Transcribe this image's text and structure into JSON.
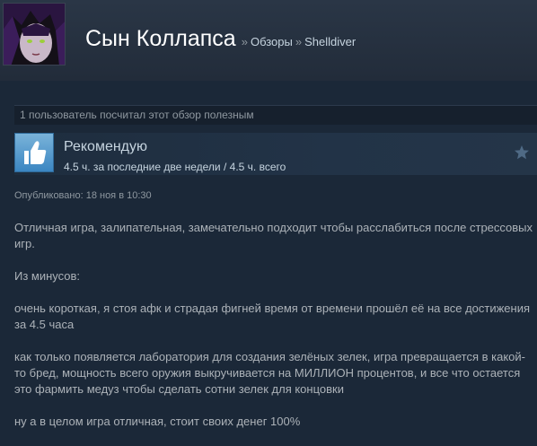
{
  "header": {
    "persona_name": "Сын Коллапса",
    "breadcrumb_sep": "»",
    "breadcrumb_reviews": "Обзоры",
    "breadcrumb_game": "Shelldiver"
  },
  "helpful": {
    "text": "1 пользователь посчитал этот обзор полезным"
  },
  "recommendation": {
    "title": "Рекомендую",
    "hours": "4.5 ч. за последние две недели / 4.5 ч. всего"
  },
  "posted": "Опубликовано: 18 ноя в 10:30",
  "review": {
    "paragraphs": [
      "Отличная игра, залипательная, замечательно подходит чтобы расслабиться после стрессовых игр.",
      "Из минусов:",
      "очень короткая, я стоя афк и страдая фигней время от времени прошёл её на все достижения за 4.5 часа",
      "как только появляется лаборатория для создания зелёных зелек, игра превращается в какой-то бред, мощность всего оружия выкручивается на МИЛЛИОН процентов, и все что остается это фармить медуз чтобы сделать сотни зелек для концовки",
      "ну а в целом игра отличная, стоит своих денег 100%"
    ]
  },
  "icons": {
    "thumb": "thumbs-up-icon",
    "star": "star-icon"
  },
  "colors": {
    "background": "#1b2838",
    "thumb_blue": "#3b86c2",
    "text": "#acb2b8"
  }
}
